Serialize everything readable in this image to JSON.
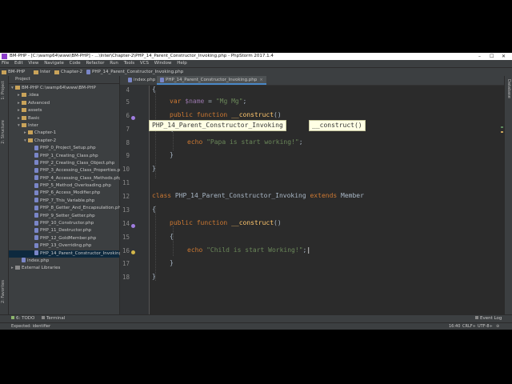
{
  "window": {
    "title": "BM-PHP - [C:\\wamp64\\www\\BM-PHP] - ...\\Inter\\Chapter-2\\PHP_14_Parent_Constructor_Invoking.php - PhpStorm 2017.1.4",
    "controls": [
      "–",
      "☐",
      "✕"
    ]
  },
  "menu": [
    "File",
    "Edit",
    "View",
    "Navigate",
    "Code",
    "Refactor",
    "Run",
    "Tools",
    "VCS",
    "Window",
    "Help"
  ],
  "breadcrumbs": [
    "BM-PHP",
    "Inter",
    "Chapter-2",
    "PHP_14_Parent_Constructor_Invoking.php"
  ],
  "left_tabs": [
    "1: Project",
    "2: Structure",
    "2: Favorites"
  ],
  "right_tabs": [
    "Database"
  ],
  "project_panel": {
    "header": "Project",
    "root": "BM-PHP  C:\\wamp64\\www\\BM-PHP",
    "items": [
      {
        "label": "BM-PHP  C:\\wamp64\\www\\BM-PHP",
        "kind": "folder",
        "depth": 0
      },
      {
        "label": ".idea",
        "kind": "folder",
        "depth": 1
      },
      {
        "label": "Advanced",
        "kind": "folder",
        "depth": 1
      },
      {
        "label": "assets",
        "kind": "folder",
        "depth": 1
      },
      {
        "label": "Basic",
        "kind": "folder",
        "depth": 1
      },
      {
        "label": "Inter",
        "kind": "folder",
        "depth": 1
      },
      {
        "label": "Chapter-1",
        "kind": "folder",
        "depth": 2
      },
      {
        "label": "Chapter-2",
        "kind": "folder",
        "depth": 2
      },
      {
        "label": "PHP_0_Project_Setup.php",
        "kind": "php",
        "depth": 3
      },
      {
        "label": "PHP_1_Creating_Class.php",
        "kind": "php",
        "depth": 3
      },
      {
        "label": "PHP_2_Creating_Class_Object.php",
        "kind": "php",
        "depth": 3
      },
      {
        "label": "PHP_3_Accessing_Class_Properties.php",
        "kind": "php",
        "depth": 3
      },
      {
        "label": "PHP_4_Accessing_Class_Methods.php",
        "kind": "php",
        "depth": 3
      },
      {
        "label": "PHP_5_Method_Overloading.php",
        "kind": "php",
        "depth": 3
      },
      {
        "label": "PHP_6_Access_Modifier.php",
        "kind": "php",
        "depth": 3
      },
      {
        "label": "PHP_7_This_Variable.php",
        "kind": "php",
        "depth": 3
      },
      {
        "label": "PHP_8_Getter_And_Encapsulation.php",
        "kind": "php",
        "depth": 3
      },
      {
        "label": "PHP_9_Setter_Getter.php",
        "kind": "php",
        "depth": 3
      },
      {
        "label": "PHP_10_Constructor.php",
        "kind": "php",
        "depth": 3
      },
      {
        "label": "PHP_11_Destructor.php",
        "kind": "php",
        "depth": 3
      },
      {
        "label": "PHP_12_GoldMember.php",
        "kind": "php",
        "depth": 3
      },
      {
        "label": "PHP_13_Overriding.php",
        "kind": "php",
        "depth": 3
      },
      {
        "label": "PHP_14_Parent_Constructor_Invoking.php",
        "kind": "php",
        "depth": 3,
        "selected": true
      },
      {
        "label": "index.php",
        "kind": "php",
        "depth": 1
      },
      {
        "label": "External Libraries",
        "kind": "lib",
        "depth": 0
      }
    ]
  },
  "editor": {
    "tabs": [
      {
        "label": "index.php",
        "active": false
      },
      {
        "label": "PHP_14_Parent_Constructor_Invoking.php",
        "active": true
      }
    ],
    "hint": {
      "class": "PHP_14_Parent_Constructor_Invoking",
      "method": "__construct()"
    },
    "line_numbers": [
      "4",
      "5",
      "6",
      "7",
      "8",
      "9",
      "10",
      "11",
      "12",
      "13",
      "14",
      "15",
      "16",
      "17",
      "18"
    ],
    "code": {
      "l4": "{",
      "l5_kw": "var ",
      "l5_var": "$name",
      "l5_rest": " = ",
      "l5_str": "\"Mg Mg\"",
      "l5_end": ";",
      "l6_kw": "public function ",
      "l6_fn": "__construct",
      "l6_rest": "()",
      "l7": "{",
      "l8_kw": "echo ",
      "l8_str": "\"Papa is start working!\"",
      "l8_end": ";",
      "l9": "}",
      "l11": "}",
      "l12_kw1": "class ",
      "l12_name": "PHP_14_Parent_Constructor_Invoking",
      "l12_kw2": " extends ",
      "l12_parent": "Member",
      "l13": "{",
      "l14_kw": "public function ",
      "l14_fn": "__construct",
      "l14_rest": "()",
      "l15": "{",
      "l16_kw": "echo ",
      "l16_str": "\"Child is start Working!\"",
      "l16_end": ";",
      "l17": "}",
      "l18": "}"
    }
  },
  "tool_windows": {
    "todo": "6: TODO",
    "terminal": "Terminal",
    "event_log": "Event Log"
  },
  "status": {
    "message": "Expected: identifier",
    "position": "16:40",
    "line_sep": "CRLF÷",
    "encoding": "UTF-8÷"
  },
  "colors": {
    "keyword": "#cc7832",
    "string": "#6a8759",
    "variable": "#9876aa",
    "function": "#ffc66d",
    "background": "#2b2b2b"
  }
}
